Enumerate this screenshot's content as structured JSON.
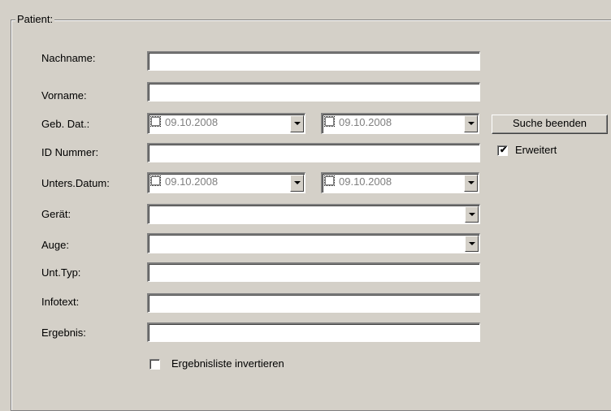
{
  "group": {
    "title": "Patient:"
  },
  "fields": {
    "nachname": {
      "label": "Nachname:",
      "value": ""
    },
    "vorname": {
      "label": "Vorname:",
      "value": ""
    },
    "geb_dat": {
      "label": "Geb. Dat.:",
      "from": "09.10.2008",
      "to": "09.10.2008"
    },
    "id_nummer": {
      "label": "ID Nummer:",
      "value": ""
    },
    "unters_datum": {
      "label": "Unters.Datum:",
      "from": "09.10.2008",
      "to": "09.10.2008"
    },
    "geraet": {
      "label": "Gerät:",
      "value": ""
    },
    "auge": {
      "label": "Auge:",
      "value": ""
    },
    "unt_typ": {
      "label": "Unt.Typ:",
      "value": ""
    },
    "infotext": {
      "label": "Infotext:",
      "value": ""
    },
    "ergebnis": {
      "label": "Ergebnis:",
      "value": ""
    }
  },
  "actions": {
    "suche_beenden": "Suche beenden",
    "erweitert": {
      "label": "Erweitert",
      "checked": true
    },
    "invertieren": {
      "label": "Ergebnisliste invertieren",
      "checked": false
    }
  }
}
